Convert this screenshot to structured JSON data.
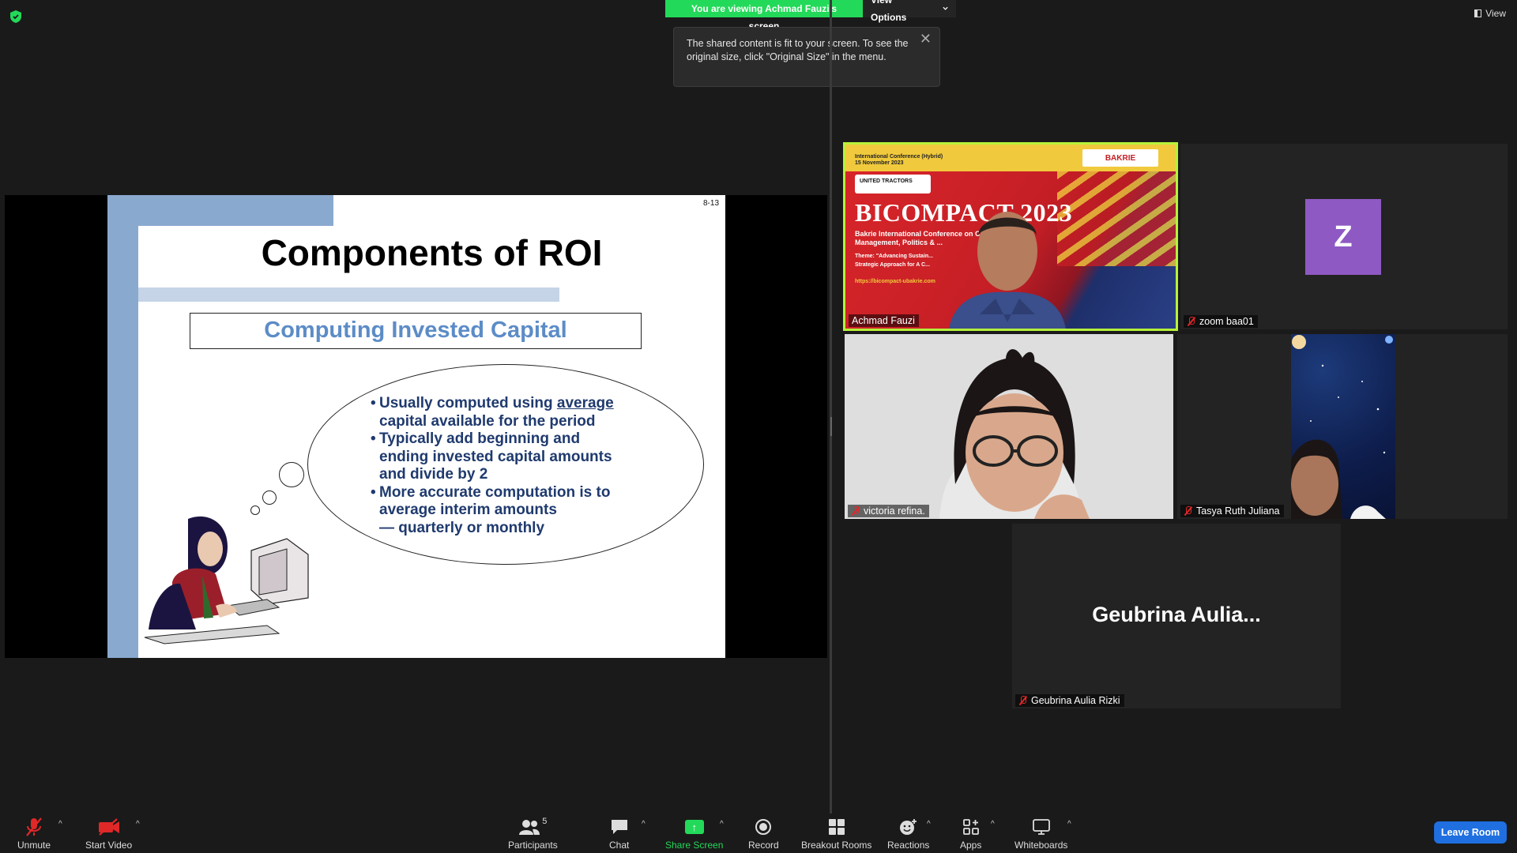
{
  "topbar": {
    "viewing_text": "You are viewing Achmad Fauzi's screen",
    "view_options_label": "View Options",
    "view_label": "View"
  },
  "tooltip": {
    "text": "The shared content is fit to your screen. To see the original size, click \"Original Size\" in the menu."
  },
  "slide": {
    "number": "8-13",
    "title": "Components of ROI",
    "subtitle": "Computing Invested Capital",
    "bullet1_a": "Usually computed using ",
    "bullet1_b": "average",
    "bullet1_c": "capital available for the period",
    "bullet2_a": "Typically add beginning and",
    "bullet2_b": "ending invested capital amounts",
    "bullet2_c": "and divide by 2",
    "bullet3_a": "More accurate computation is to",
    "bullet3_b": "average interim amounts",
    "bullet3_c": "— quarterly or monthly"
  },
  "conference_banner": {
    "line1": "International Conference (Hybrid)",
    "line2": "15 November 2023",
    "sponsor": "UNITED TRACTORS",
    "university": "BAKRIE",
    "title": "BICOMPACT 2023",
    "desc1": "Bakrie International Conference on Communication,",
    "desc2": "Management, Politics & ...",
    "theme1": "Theme: \"Advancing Sustain...",
    "theme2": "Strategic Approach for A C...",
    "url": "https://bicompact-ubakrie.com"
  },
  "participants": [
    {
      "name": "Achmad Fauzi",
      "muted": false
    },
    {
      "name": "zoom baa01",
      "muted": true,
      "initial": "Z"
    },
    {
      "name": "victoria refina.",
      "muted": true
    },
    {
      "name": "Tasya Ruth Juliana",
      "muted": true
    },
    {
      "name": "Geubrina Aulia Rizki",
      "muted": true,
      "display": "Geubrina  Aulia..."
    }
  ],
  "toolbar": {
    "unmute": "Unmute",
    "start_video": "Start Video",
    "participants": "Participants",
    "participants_count": "5",
    "chat": "Chat",
    "share_screen": "Share Screen",
    "record": "Record",
    "breakout_rooms": "Breakout Rooms",
    "reactions": "Reactions",
    "apps": "Apps",
    "whiteboards": "Whiteboards",
    "leave_room": "Leave Room"
  },
  "colors": {
    "accent_green": "#23d959",
    "leave_blue": "#1f6fe0",
    "active_speaker": "#b6f23a",
    "avatar_purple": "#8f59c4",
    "muted_red": "#e02828"
  }
}
